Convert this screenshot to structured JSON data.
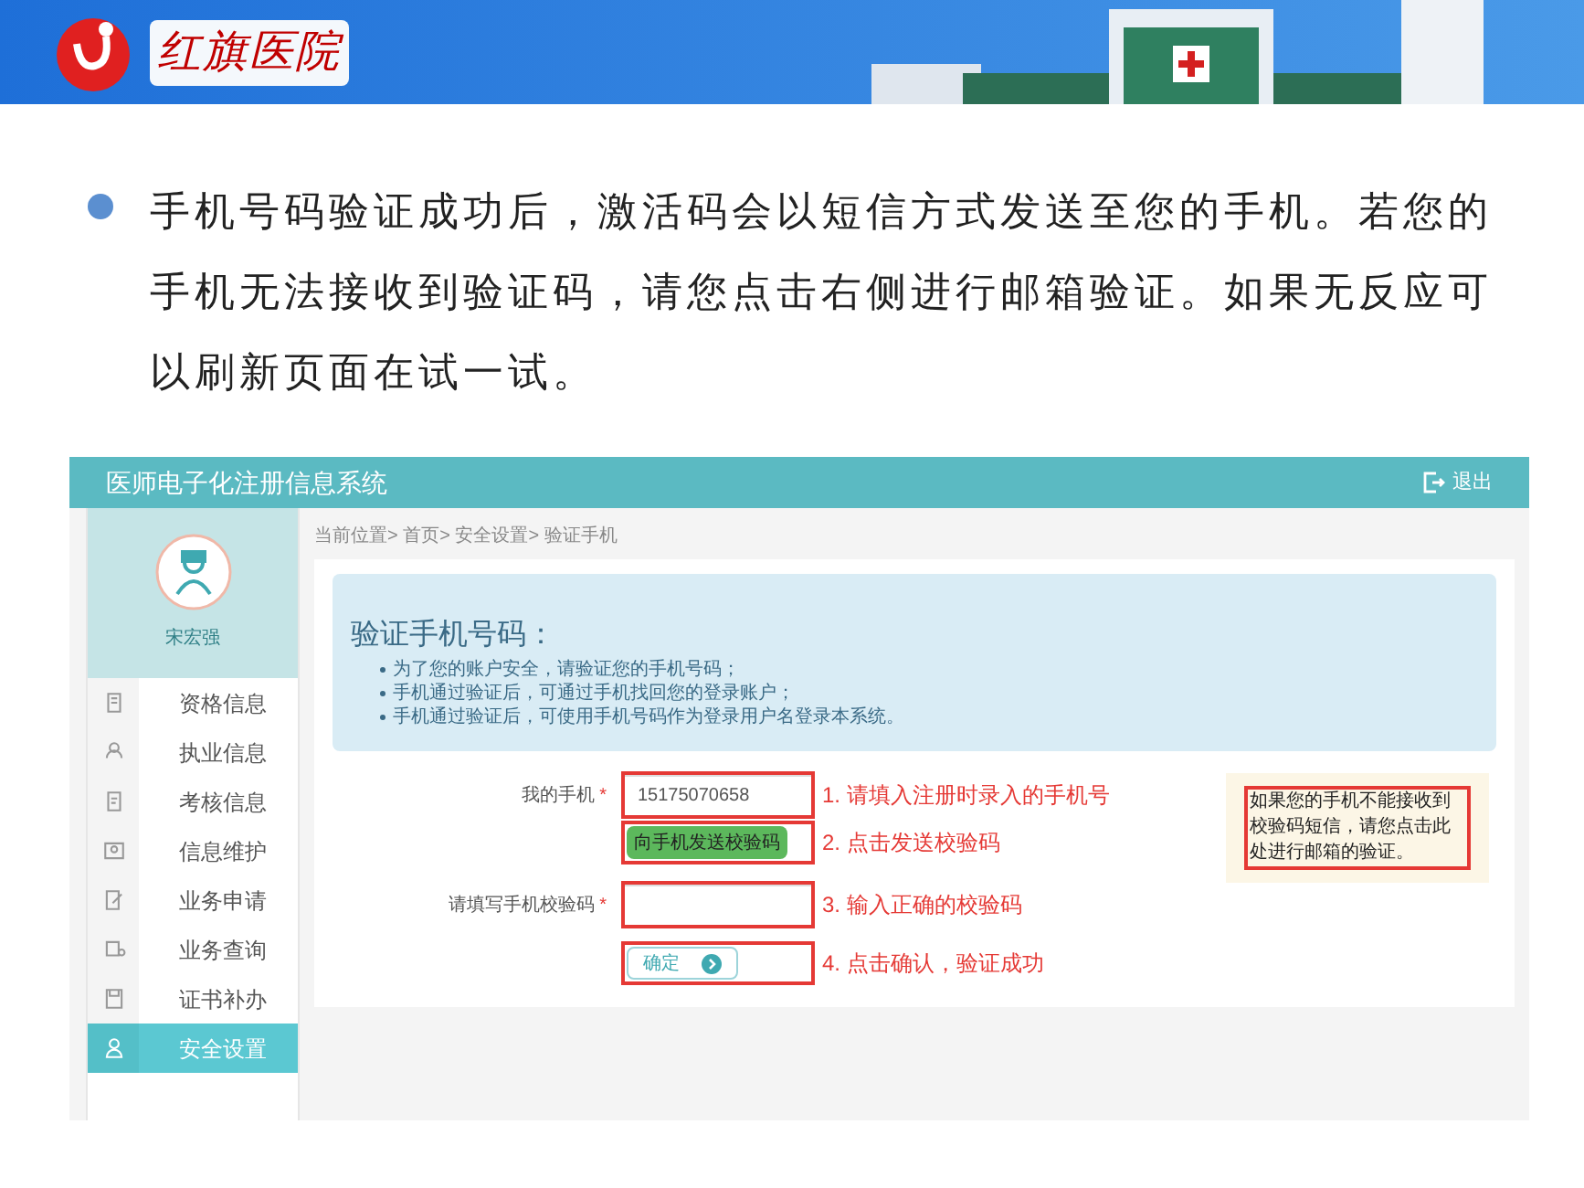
{
  "banner": {
    "logo_text": "红旗医院"
  },
  "intro": {
    "text": "手机号码验证成功后，激活码会以短信方式发送至您的手机。若您的手机无法接收到验证码，请您点击右侧进行邮箱验证。如果无反应可以刷新页面在试一试。"
  },
  "app": {
    "title": "医师电子化注册信息系统",
    "logout": "退出",
    "user_name": "宋宏强",
    "menu": [
      {
        "label": "资格信息",
        "selected": false
      },
      {
        "label": "执业信息",
        "selected": false
      },
      {
        "label": "考核信息",
        "selected": false
      },
      {
        "label": "信息维护",
        "selected": false
      },
      {
        "label": "业务申请",
        "selected": false
      },
      {
        "label": "业务查询",
        "selected": false
      },
      {
        "label": "证书补办",
        "selected": false
      },
      {
        "label": "安全设置",
        "selected": true
      }
    ],
    "breadcrumb": "当前位置> 首页> 安全设置> 验证手机",
    "heading": "验证手机号码：",
    "tips": [
      "为了您的账户安全，请验证您的手机号码；",
      "手机通过验证后，可通过手机找回您的登录账户；",
      "手机通过验证后，可使用手机号码作为登录用户名登录本系统。"
    ],
    "form": {
      "phone_label": "我的手机",
      "phone_value": "15175070658",
      "required_mark": "*",
      "send_button": "向手机发送校验码",
      "code_label": "请填写手机校验码",
      "confirm_button": "确定"
    },
    "annotations": [
      "1. 请填入注册时录入的手机号",
      "2. 点击发送校验码",
      "3. 输入正确的校验码",
      "4. 点击确认，验证成功"
    ],
    "note": "如果您的手机不能接收到校验码短信，请您点击此处进行邮箱的验证。"
  }
}
